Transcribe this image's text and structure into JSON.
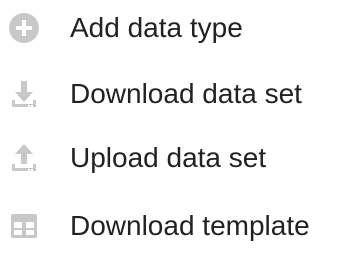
{
  "menu": {
    "icon_color": "#c8c8c8",
    "items": [
      {
        "label": "Add data type",
        "icon": "add-circle-icon"
      },
      {
        "label": "Download data set",
        "icon": "download-icon"
      },
      {
        "label": "Upload data set",
        "icon": "upload-icon"
      },
      {
        "label": "Download template",
        "icon": "template-icon"
      }
    ]
  }
}
